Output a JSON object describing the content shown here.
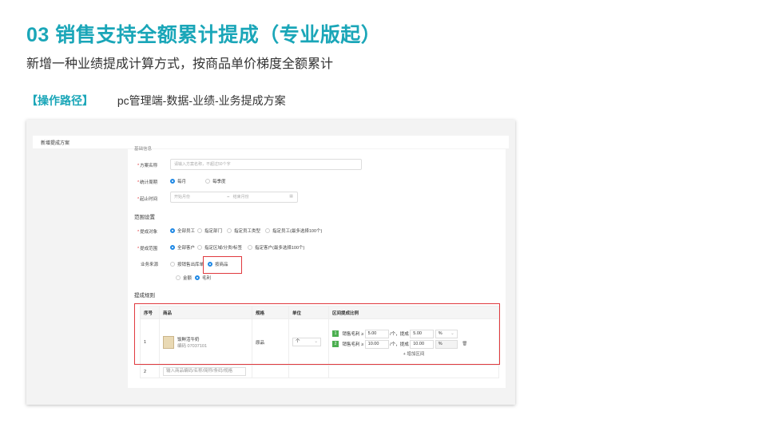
{
  "slide": {
    "title": "03  销售支持全额累计提成（专业版起）",
    "subtitle": "新增一种业绩提成计算方式，按商品单价梯度全额累计",
    "path_tag": "【操作路径】",
    "path_text": "pc管理端-数据-业绩-业务提成方案"
  },
  "window": {
    "title": "新增提成方案",
    "section_basic": "基础信息",
    "plan_name_label": "方案名称",
    "plan_name_placeholder": "请输入方案名称，不超过50个字",
    "period_label": "统计周期",
    "period_monthly": "每月",
    "period_quarterly": "每季度",
    "time_label": "起止时间",
    "start_placeholder": "开始月份",
    "end_placeholder": "结束月份",
    "dash": "–",
    "section_scope": "范围设置",
    "target_label": "提成对象",
    "target_opts": [
      "全部员工",
      "指定部门",
      "指定员工类型",
      "指定员工(最多选择100个)"
    ],
    "range_label": "提成范围",
    "range_opts": [
      "全部客户",
      "指定区域/分类/标签",
      "指定客户(最多选择100个)"
    ],
    "source_label": "业务来源",
    "source_opt1": "按销售出库单",
    "source_opt2": "按商品",
    "calc_opt1": "金额",
    "calc_opt2": "毛利",
    "section_rules": "提成规则",
    "table_headers": [
      "序号",
      "商品",
      "规格",
      "单位",
      "区间提成比例"
    ],
    "row1": {
      "index": "1",
      "product_name": "饭鲜活牛奶",
      "product_code": "编码  07037101",
      "spec": "原品",
      "unit": "个",
      "tiers": [
        {
          "no": "1",
          "label": "销售毛利",
          "op": "≥",
          "value": "5.00",
          "mid": "/个，提成",
          "rate": "5.00",
          "unit": "%"
        },
        {
          "no": "2",
          "label": "销售毛利",
          "op": "≥",
          "value": "10.00",
          "mid": "/个，提成",
          "rate": "10.00",
          "unit": "%"
        }
      ],
      "add_tier": "+ 增加区间"
    },
    "row2": {
      "index": "2",
      "placeholder": "输入商品编码/名称/简称/条码/规格"
    }
  },
  "colors": {
    "accent": "#1aa6b8",
    "highlight": "#e0393e",
    "radio_on": "#1e88e5"
  }
}
